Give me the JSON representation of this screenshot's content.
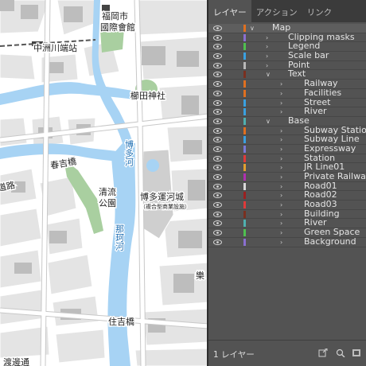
{
  "map": {
    "labels": {
      "fukuoka_city": "福岡市",
      "international_hall": "國際會館",
      "nakasu_station": "中洲川端站",
      "kushida_shrine": "櫛田神社",
      "haruyoshi_bridge": "春吉橋",
      "hakata_river": "博多河",
      "canal_city": "博多運河城",
      "canal_city_sub": "（複合型商業設施）",
      "seiryu_park": "清流公園",
      "naka_river": "那珂河",
      "sumiyoshi_bridge": "住吉橋",
      "road_left": "道路",
      "watanabe": "渡邊通",
      "partial_right": "樂"
    },
    "colors": {
      "water": "#a7d3f4",
      "park": "#a9cfa0",
      "block": "#e3e3e3",
      "road": "#ffffff",
      "building": "#bdbdbd"
    }
  },
  "panel": {
    "tabs": [
      "レイヤー",
      "アクション",
      "リンク"
    ],
    "active_tab": 0,
    "layers": [
      {
        "name": "Map",
        "level": 0,
        "expanded": true,
        "color": "#e07020"
      },
      {
        "name": "Clipping masks",
        "level": 1,
        "expanded": false,
        "color": "#8a6fd0"
      },
      {
        "name": "Legend",
        "level": 1,
        "expanded": false,
        "color": "#4fc04f"
      },
      {
        "name": "Scale bar",
        "level": 1,
        "expanded": false,
        "color": "#3aa0e0"
      },
      {
        "name": "Point",
        "level": 1,
        "expanded": false,
        "color": "#b8b8b8"
      },
      {
        "name": "Text",
        "level": 1,
        "expanded": true,
        "color": "#7a3020"
      },
      {
        "name": "Railway",
        "level": 2,
        "expanded": false,
        "color": "#e07020"
      },
      {
        "name": "Facilities",
        "level": 2,
        "expanded": false,
        "color": "#e07020"
      },
      {
        "name": "Street",
        "level": 2,
        "expanded": false,
        "color": "#3aa0e0"
      },
      {
        "name": "River",
        "level": 2,
        "expanded": false,
        "color": "#3aa0e0"
      },
      {
        "name": "Base",
        "level": 1,
        "expanded": true,
        "color": "#4fb0b0"
      },
      {
        "name": "Subway Station",
        "level": 2,
        "expanded": false,
        "color": "#e07020"
      },
      {
        "name": "Subway Line",
        "level": 2,
        "expanded": false,
        "color": "#3aa0e0"
      },
      {
        "name": "Expressway",
        "level": 2,
        "expanded": false,
        "color": "#7a7ad8"
      },
      {
        "name": "Station",
        "level": 2,
        "expanded": false,
        "color": "#e03a3a"
      },
      {
        "name": "JR Line01",
        "level": 2,
        "expanded": false,
        "color": "#e0a030"
      },
      {
        "name": "Private Railway",
        "level": 2,
        "expanded": false,
        "color": "#b030b0"
      },
      {
        "name": "Road01",
        "level": 2,
        "expanded": false,
        "color": "#d8d8d8"
      },
      {
        "name": "Road02",
        "level": 2,
        "expanded": false,
        "color": "#9a2020"
      },
      {
        "name": "Road03",
        "level": 2,
        "expanded": false,
        "color": "#e03a3a"
      },
      {
        "name": "Building",
        "level": 2,
        "expanded": false,
        "color": "#7a3020"
      },
      {
        "name": "River",
        "level": 2,
        "expanded": false,
        "color": "#4fb0b0"
      },
      {
        "name": "Green Space",
        "level": 2,
        "expanded": false,
        "color": "#4fc04f"
      },
      {
        "name": "Background",
        "level": 2,
        "expanded": false,
        "color": "#8a6fd0"
      }
    ],
    "footer": {
      "layer_count": "1 レイヤー"
    },
    "icons": [
      "eye-icon",
      "chevron-right-icon",
      "chevron-down-icon",
      "export-icon",
      "search-icon",
      "new-layer-icon"
    ]
  }
}
